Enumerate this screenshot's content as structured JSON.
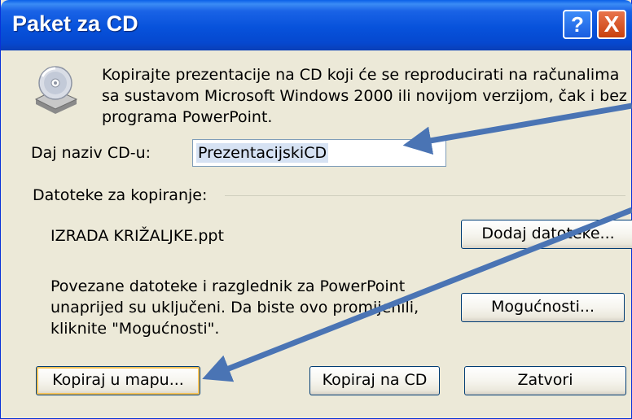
{
  "window": {
    "title": "Paket za CD",
    "help_glyph": "?",
    "close_glyph": "X"
  },
  "description": [
    "Kopirajte prezentacije na CD koji će se reproducirati na računalima",
    "sa sustavom Microsoft Windows 2000 ili novijom verzijom, čak i bez",
    "programa PowerPoint."
  ],
  "cd_name": {
    "label": "Daj naziv CD-u:",
    "value": "PrezentacijskiCD"
  },
  "files": {
    "group_label": "Datoteke za kopiranje:",
    "file_name": "IZRADA KRIŽALJKE.ppt",
    "add_button": "Dodaj datoteke...",
    "linked_note": [
      "Povezane datoteke i razglednik za PowerPoint",
      "unaprijed su uključeni. Da biste ovo promijenili,",
      "kliknite \"Mogućnosti\"."
    ],
    "options_button": "Mogućnosti..."
  },
  "buttons": {
    "copy_folder": "Kopiraj u mapu...",
    "copy_cd": "Kopiraj na CD",
    "close": "Zatvori"
  },
  "colors": {
    "titlebar": "#0752db",
    "dialog_bg": "#ece9d8",
    "arrow": "#4a74b4",
    "selection": "#d6e2f3"
  },
  "icons": [
    "cd-drive-icon",
    "help-icon",
    "close-icon"
  ]
}
